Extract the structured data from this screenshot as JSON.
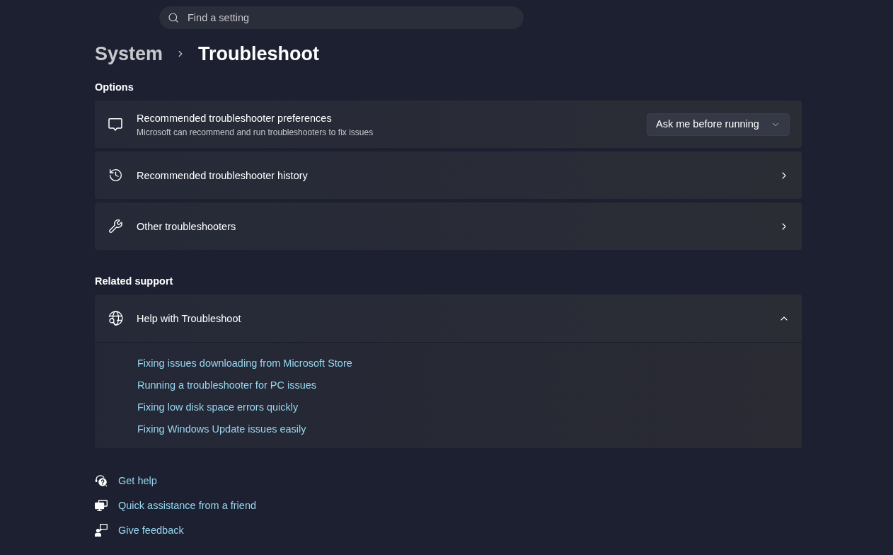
{
  "search": {
    "placeholder": "Find a setting"
  },
  "breadcrumb": [
    {
      "label": "System",
      "current": false
    },
    {
      "label": "Troubleshoot",
      "current": true
    }
  ],
  "options": {
    "heading": "Options",
    "items": [
      {
        "kind": "dropdown",
        "title": "Recommended troubleshooter preferences",
        "description": "Microsoft can recommend and run troubleshooters to fix issues",
        "value": "Ask me before running"
      },
      {
        "kind": "link",
        "title": "Recommended troubleshooter history"
      },
      {
        "kind": "link",
        "title": "Other troubleshooters"
      }
    ]
  },
  "related_support": {
    "heading": "Related support",
    "help": {
      "title": "Help with Troubleshoot",
      "expanded": true,
      "links": [
        "Fixing issues downloading from Microsoft Store",
        "Running a troubleshooter for PC issues",
        "Fixing low disk space errors quickly",
        "Fixing Windows Update issues easily"
      ]
    }
  },
  "footer_links": [
    "Get help",
    "Quick assistance from a friend",
    "Give feedback"
  ]
}
